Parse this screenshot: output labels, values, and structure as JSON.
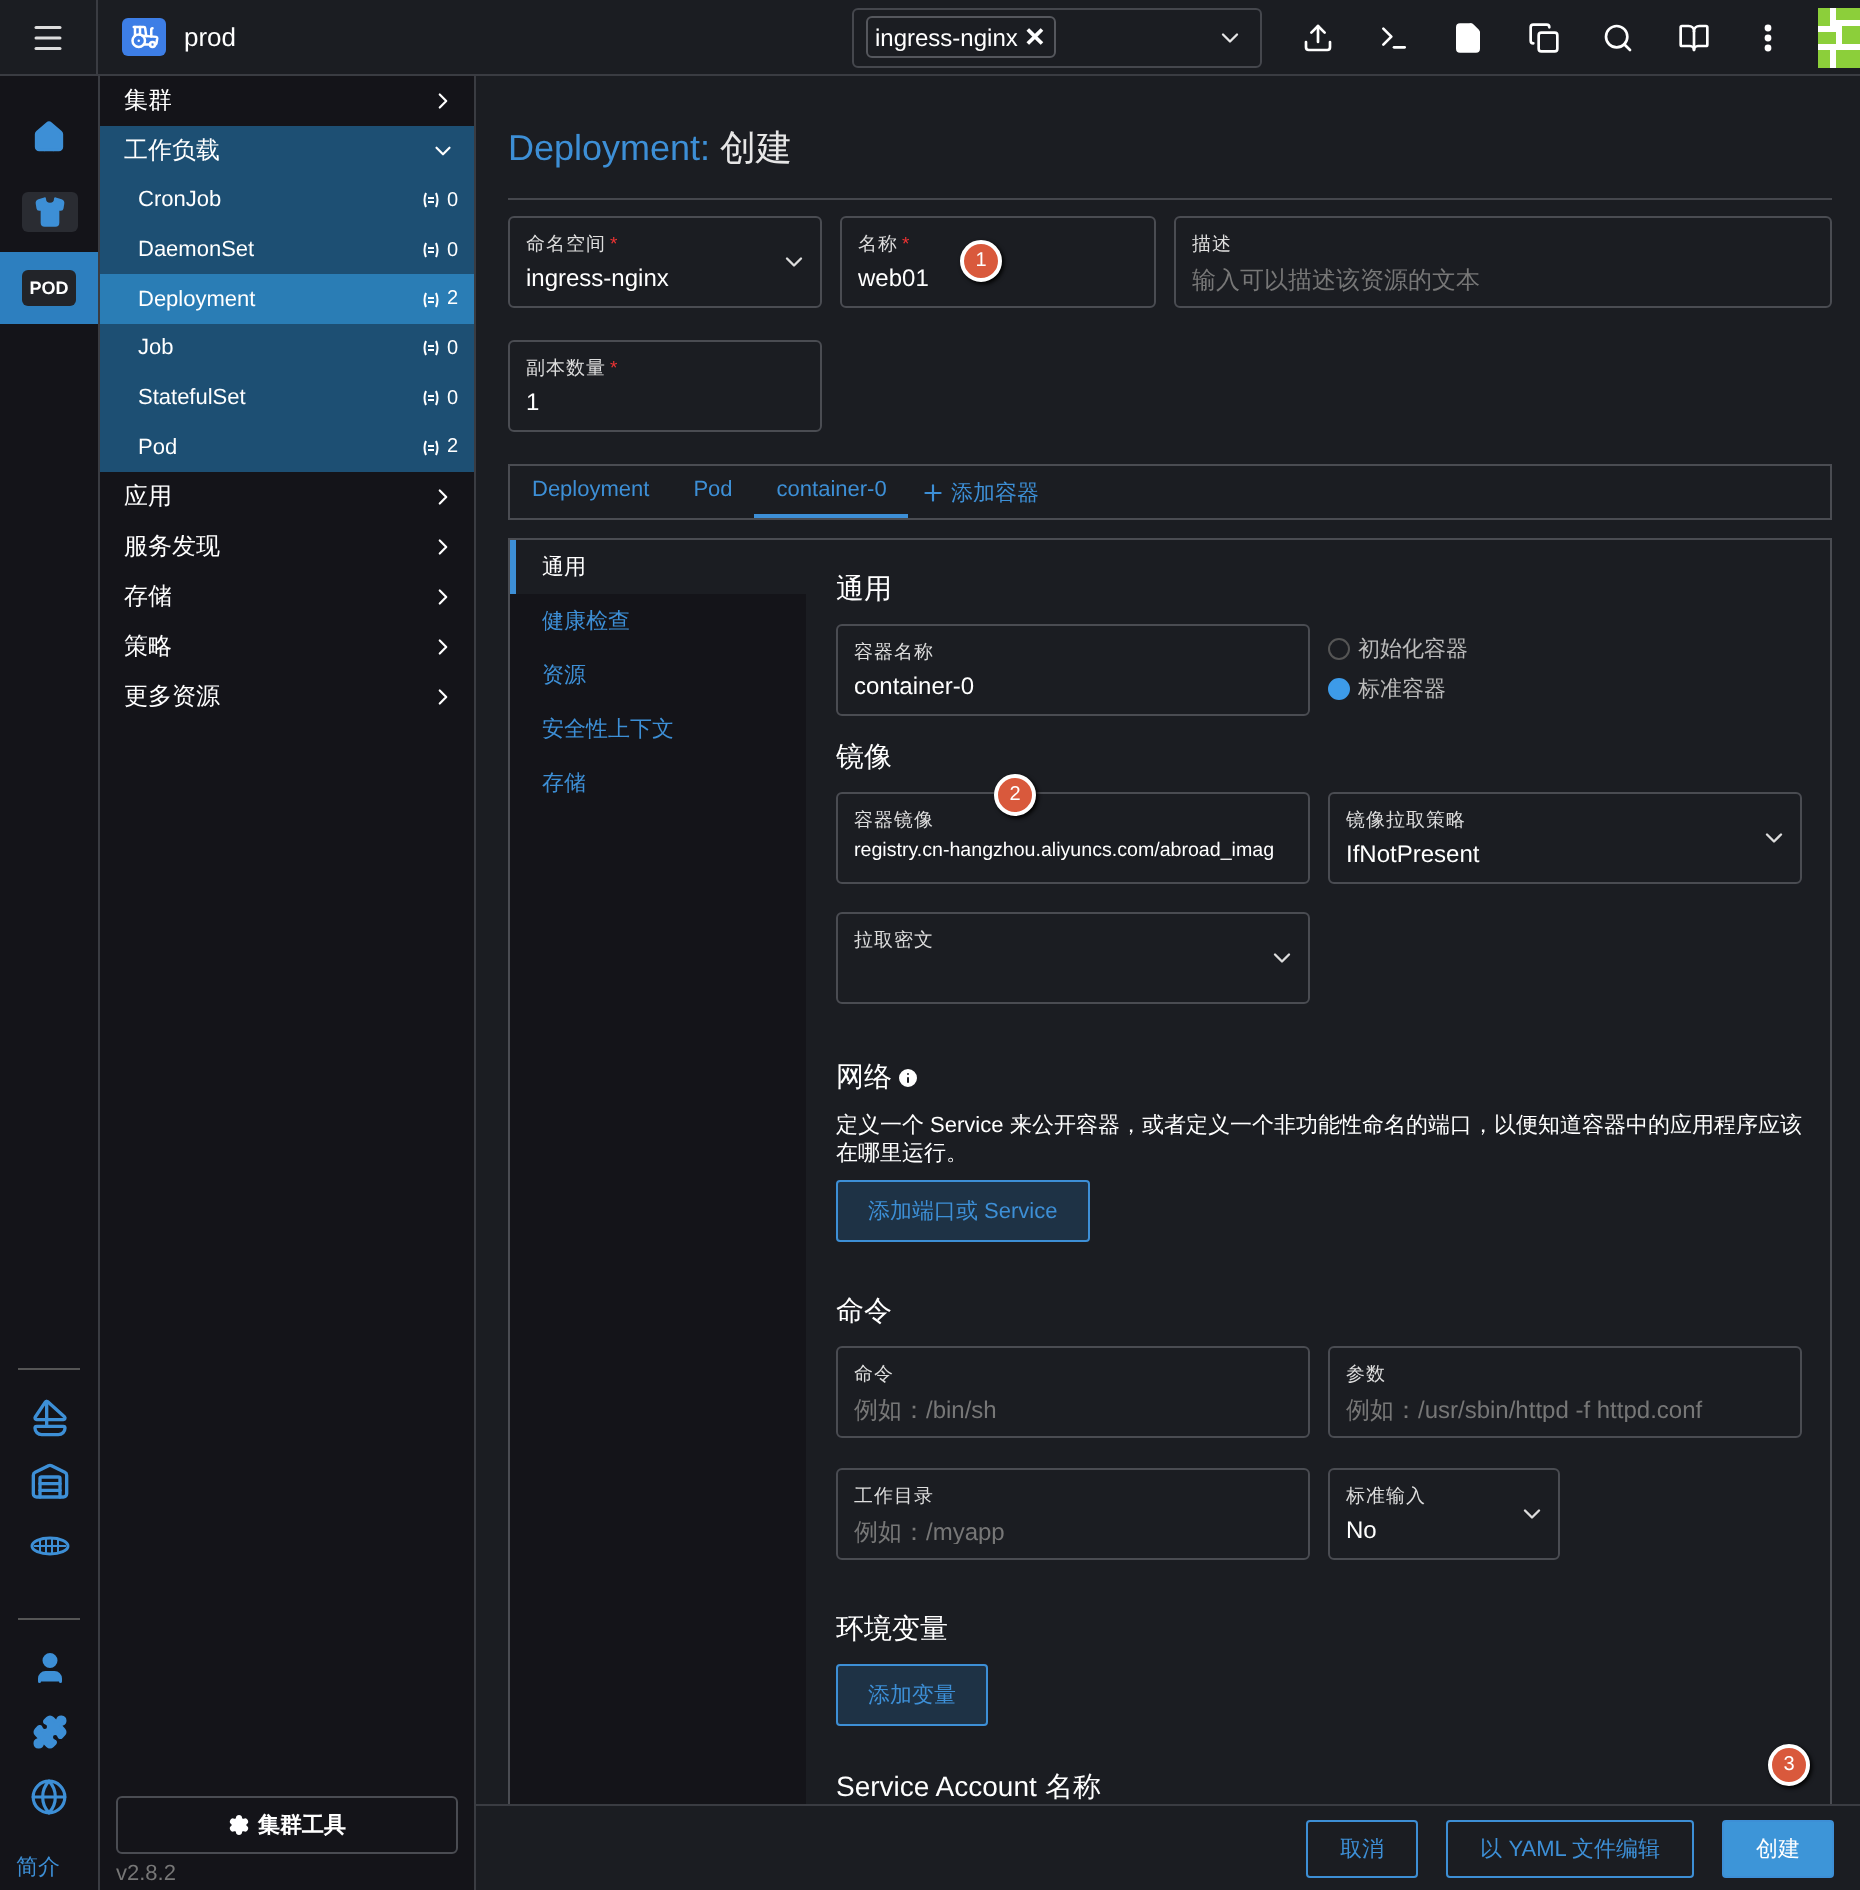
{
  "header": {
    "cluster": "prod",
    "namespace_filter": {
      "chips": [
        "ingress-nginx"
      ],
      "remove": "✕"
    }
  },
  "rail": {
    "items": [
      {
        "kind": "home",
        "selected": false
      },
      {
        "kind": "shirt",
        "selected": false
      },
      {
        "kind": "pod",
        "label": "POD",
        "selected": true
      }
    ],
    "about": "简介",
    "version": "v2.8.2"
  },
  "nav": {
    "items": [
      {
        "label": "集群",
        "expanded": false
      },
      {
        "label": "工作负载",
        "expanded": true,
        "children": [
          {
            "label": "CronJob",
            "count": "0",
            "selected": false
          },
          {
            "label": "DaemonSet",
            "count": "0",
            "selected": false
          },
          {
            "label": "Deployment",
            "count": "2",
            "selected": true
          },
          {
            "label": "Job",
            "count": "0",
            "selected": false
          },
          {
            "label": "StatefulSet",
            "count": "0",
            "selected": false
          },
          {
            "label": "Pod",
            "count": "2",
            "selected": false
          }
        ]
      },
      {
        "label": "应用",
        "expanded": false
      },
      {
        "label": "服务发现",
        "expanded": false
      },
      {
        "label": "存储",
        "expanded": false
      },
      {
        "label": "策略",
        "expanded": false
      },
      {
        "label": "更多资源",
        "expanded": false
      }
    ],
    "cluster_tools": "集群工具"
  },
  "page": {
    "resource": "Deployment:",
    "action": "创建"
  },
  "fields": [
    {
      "kind": "select",
      "label": "命名空间",
      "required": true,
      "value": "ingress-nginx"
    },
    {
      "kind": "text",
      "label": "名称",
      "required": true,
      "value": "web01"
    },
    {
      "kind": "text",
      "label": "描述",
      "required": false,
      "placeholder": "输入可以描述该资源的文本"
    },
    {
      "kind": "text",
      "label": "副本数量",
      "required": true,
      "value": "1"
    }
  ],
  "tabs": [
    {
      "label": "Deployment",
      "selected": false
    },
    {
      "label": "Pod",
      "selected": false
    },
    {
      "label": "container-0",
      "selected": true
    }
  ],
  "add_container": "添加容器",
  "side_tabs": [
    {
      "label": "通用",
      "selected": true
    },
    {
      "label": "健康检查",
      "selected": false
    },
    {
      "label": "资源",
      "selected": false
    },
    {
      "label": "安全性上下文",
      "selected": false
    },
    {
      "label": "存储",
      "selected": false
    }
  ],
  "general": {
    "title": "通用",
    "container_name": {
      "label": "容器名称",
      "value": "container-0"
    },
    "container_types": [
      {
        "label": "初始化容器",
        "selected": false
      },
      {
        "label": "标准容器",
        "selected": true
      }
    ]
  },
  "image": {
    "title": "镜像",
    "image_field": {
      "label": "容器镜像",
      "value": "registry.cn-hangzhou.aliyuncs.com/abroad_imag"
    },
    "pull_policy": {
      "label": "镜像拉取策略",
      "value": "IfNotPresent"
    },
    "pull_secret": {
      "label": "拉取密文"
    }
  },
  "network": {
    "title": "网络",
    "description": "定义一个 Service 来公开容器，或者定义一个非功能性命名的端口，以便知道容器中的应用程序应该在哪里运行。",
    "button": "添加端口或 Service"
  },
  "command": {
    "title": "命令",
    "command": {
      "label": "命令",
      "placeholder": "例如：/bin/sh"
    },
    "args": {
      "label": "参数",
      "placeholder": "例如：/usr/sbin/httpd -f httpd.conf"
    },
    "workdir": {
      "label": "工作目录",
      "placeholder": "例如：/myapp"
    },
    "stdin": {
      "label": "标准输入",
      "value": "No"
    }
  },
  "env": {
    "title": "环境变量",
    "button": "添加变量"
  },
  "service_account": {
    "title": "Service Account 名称"
  },
  "footer": {
    "buttons": [
      {
        "label": "取消",
        "kind": "outline"
      },
      {
        "label": "以 YAML 文件编辑",
        "kind": "outline"
      },
      {
        "label": "创建",
        "kind": "primary"
      }
    ]
  },
  "markers": [
    "1",
    "2",
    "3"
  ],
  "required_mark": "*"
}
